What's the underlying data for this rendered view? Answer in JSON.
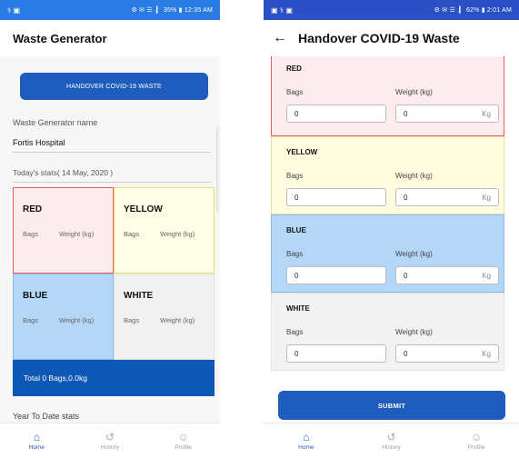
{
  "colors": {
    "primary": "#1e5dbd",
    "status_bar_left": "#2a7be4",
    "status_bar_right": "#2b4fc4",
    "red_bg": "#fdeced",
    "yellow_bg": "#fefde6",
    "blue_bg": "#b4d7f7",
    "white_bg": "#f1f1f1",
    "total_bar": "#0d57b5"
  },
  "left_screen": {
    "status_bar": {
      "icons_left": "⚕ ▣",
      "right_text": "⚙ ✉ ☰ .▎ 35% ▮ 12:35 AM"
    },
    "title": "Waste Generator",
    "handover_button": "HANDOVER COVID-19 WASTE",
    "generator_name_label": "Waste Generator name",
    "generator_name_value": "Fortis Hospital",
    "stats_label": "Today's stats( 14 May, 2020 )",
    "quadrants": [
      {
        "title": "RED",
        "bags_label": "Bags",
        "weight_label": "Weight (kg)"
      },
      {
        "title": "YELLOW",
        "bags_label": "Bags",
        "weight_label": "Weight (kg)"
      },
      {
        "title": "BLUE",
        "bags_label": "Bags",
        "weight_label": "Weight (kg)"
      },
      {
        "title": "WHITE",
        "bags_label": "Bags",
        "weight_label": "Weight (kg)"
      }
    ],
    "total_text": "Total 0 Bags,0.0kg",
    "ytd_label": "Year To Date stats"
  },
  "right_screen": {
    "status_bar": {
      "icons_left": "▣ ⚕ ▣",
      "right_text": "⚙ ✉ ☰ .▎ 62% ▮ 2:01 AM"
    },
    "title": "Handover COVID-19 Waste",
    "cards": [
      {
        "title": "RED",
        "bags_label": "Bags",
        "weight_label": "Weight (kg)",
        "bags_value": "0",
        "weight_value": "0",
        "unit": "Kg"
      },
      {
        "title": "YELLOW",
        "bags_label": "Bags",
        "weight_label": "Weight (kg)",
        "bags_value": "0",
        "weight_value": "0",
        "unit": "Kg"
      },
      {
        "title": "BLUE",
        "bags_label": "Bags",
        "weight_label": "Weight (kg)",
        "bags_value": "0",
        "weight_value": "0",
        "unit": "Kg"
      },
      {
        "title": "WHITE",
        "bags_label": "Bags",
        "weight_label": "Weight (kg)",
        "bags_value": "0",
        "weight_value": "0",
        "unit": "Kg"
      }
    ],
    "submit_button": "SUBMIT"
  },
  "bottom_nav": [
    {
      "label": "Home",
      "icon": "home-icon"
    },
    {
      "label": "History",
      "icon": "history-icon"
    },
    {
      "label": "Profile",
      "icon": "profile-icon"
    }
  ]
}
